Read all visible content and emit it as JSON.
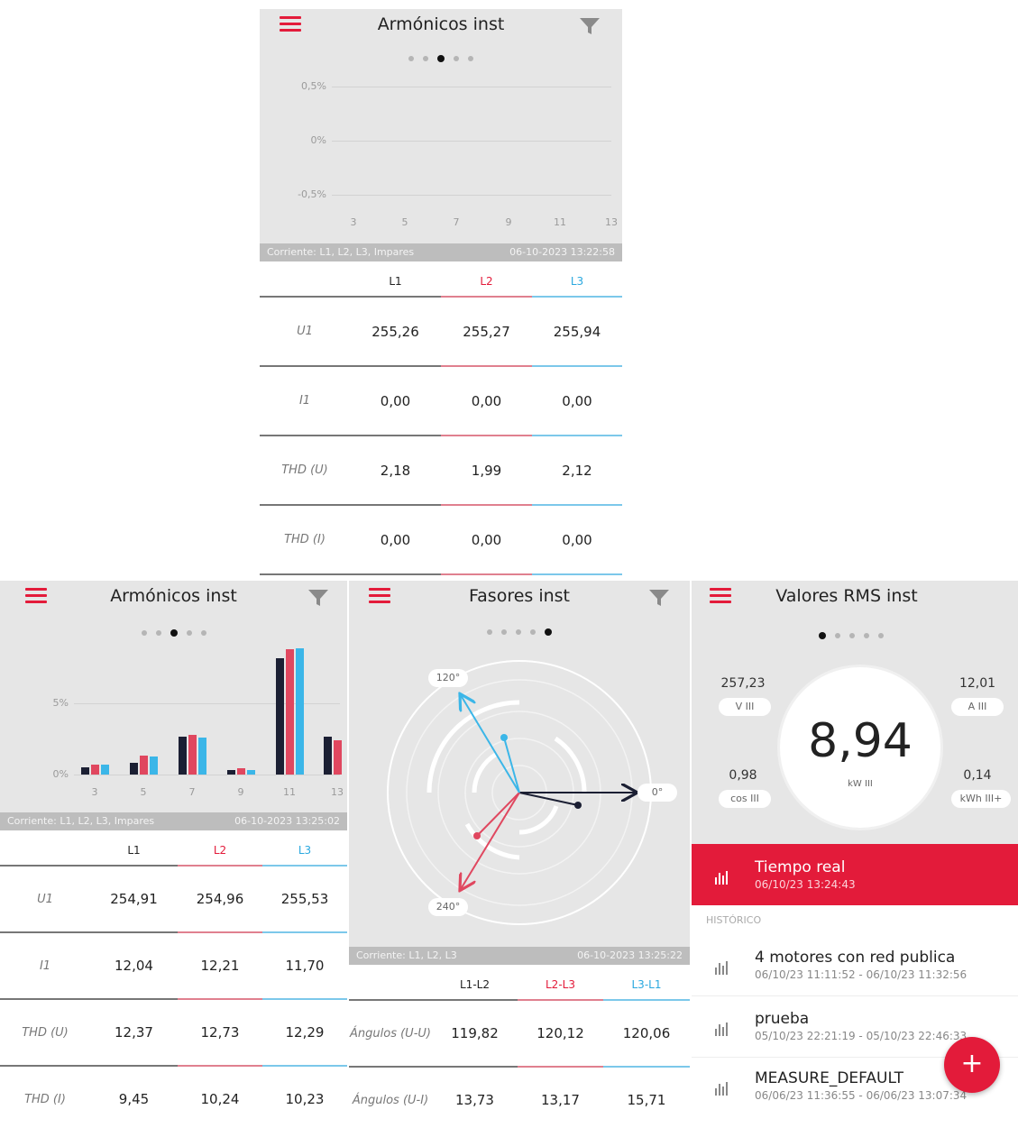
{
  "colors": {
    "accent": "#e31b3a",
    "l1": "#1b1f33",
    "l2": "#e0475f",
    "l3": "#3bb6e8"
  },
  "screen1": {
    "title": "Armónicos inst",
    "yticks": [
      "0,5%",
      "0%",
      "-0,5%"
    ],
    "xticks": [
      "3",
      "5",
      "7",
      "9",
      "11",
      "13"
    ],
    "footer_left": "Corriente: L1, L2, L3, Impares",
    "footer_right": "06-10-2023 13:22:58",
    "headers": [
      "L1",
      "L2",
      "L3"
    ],
    "rows": [
      {
        "label": "U1",
        "v": [
          "255,26",
          "255,27",
          "255,94"
        ]
      },
      {
        "label": "I1",
        "v": [
          "0,00",
          "0,00",
          "0,00"
        ]
      },
      {
        "label": "THD (U)",
        "v": [
          "2,18",
          "1,99",
          "2,12"
        ]
      },
      {
        "label": "THD (I)",
        "v": [
          "0,00",
          "0,00",
          "0,00"
        ]
      }
    ]
  },
  "screen2": {
    "title": "Armónicos inst",
    "yticks": [
      "5%",
      "0%"
    ],
    "xticks": [
      "3",
      "5",
      "7",
      "9",
      "11",
      "13"
    ],
    "footer_left": "Corriente: L1, L2, L3, Impares",
    "footer_right": "06-10-2023 13:25:02",
    "headers": [
      "L1",
      "L2",
      "L3"
    ],
    "rows": [
      {
        "label": "U1",
        "v": [
          "254,91",
          "254,96",
          "255,53"
        ]
      },
      {
        "label": "I1",
        "v": [
          "12,04",
          "12,21",
          "11,70"
        ]
      },
      {
        "label": "THD (U)",
        "v": [
          "12,37",
          "12,73",
          "12,29"
        ]
      },
      {
        "label": "THD (I)",
        "v": [
          "9,45",
          "10,24",
          "10,23"
        ]
      }
    ]
  },
  "chart_data": [
    {
      "type": "bar",
      "title": "",
      "categories": [
        "3",
        "5",
        "7",
        "9",
        "11",
        "13"
      ],
      "series": [
        {
          "name": "L1",
          "values": [
            0,
            0,
            0,
            0,
            0,
            0
          ]
        },
        {
          "name": "L2",
          "values": [
            0,
            0,
            0,
            0,
            0,
            0
          ]
        },
        {
          "name": "L3",
          "values": [
            0,
            0,
            0,
            0,
            0,
            0
          ]
        }
      ],
      "yticks": [
        "-0,5%",
        "0%",
        "0,5%"
      ],
      "ylim": [
        -0.6,
        0.6
      ],
      "grid": true
    },
    {
      "type": "bar",
      "title": "",
      "categories": [
        "3",
        "5",
        "7",
        "9",
        "11",
        "13"
      ],
      "series": [
        {
          "name": "L1",
          "values": [
            0.5,
            0.8,
            2.6,
            0.3,
            7.9,
            2.6
          ]
        },
        {
          "name": "L2",
          "values": [
            0.7,
            1.3,
            2.7,
            0.4,
            8.5,
            2.3
          ]
        },
        {
          "name": "L3",
          "values": [
            0.7,
            1.2,
            2.5,
            0.3,
            8.6,
            0
          ]
        }
      ],
      "yticks": [
        "0%",
        "5%"
      ],
      "ylim": [
        0,
        9.5
      ],
      "grid": true
    }
  ],
  "screen3": {
    "title": "Fasores inst",
    "angle_labels": [
      "120°",
      "0°",
      "240°"
    ],
    "footer_left": "Corriente: L1, L2, L3",
    "footer_right": "06-10-2023 13:25:22",
    "headers": [
      "L1-L2",
      "L2-L3",
      "L3-L1"
    ],
    "rows": [
      {
        "label": "Ángulos (U-U)",
        "v": [
          "119,82",
          "120,12",
          "120,06"
        ]
      },
      {
        "label": "Ángulos (U-I)",
        "v": [
          "13,73",
          "13,17",
          "15,71"
        ]
      }
    ]
  },
  "screen4": {
    "title": "Valores RMS inst",
    "main_value": "8,94",
    "main_unit": "kW III",
    "stats": [
      {
        "value": "257,23",
        "unit": "V III"
      },
      {
        "value": "12,01",
        "unit": "A III"
      },
      {
        "value": "0,98",
        "unit": "cos III"
      },
      {
        "value": "0,14",
        "unit": "kWh III+"
      }
    ],
    "realtime_name": "Tiempo real",
    "realtime_date": "06/10/23 13:24:43",
    "history_label": "HISTÓRICO",
    "history": [
      {
        "name": "4 motores con red publica",
        "date": "06/10/23 11:11:52 - 06/10/23 11:32:56"
      },
      {
        "name": "prueba",
        "date": "05/10/23 22:21:19 - 05/10/23 22:46:33"
      },
      {
        "name": "MEASURE_DEFAULT",
        "date": "06/06/23 11:36:55 - 06/06/23 13:07:34"
      }
    ],
    "fab_label": "+"
  }
}
